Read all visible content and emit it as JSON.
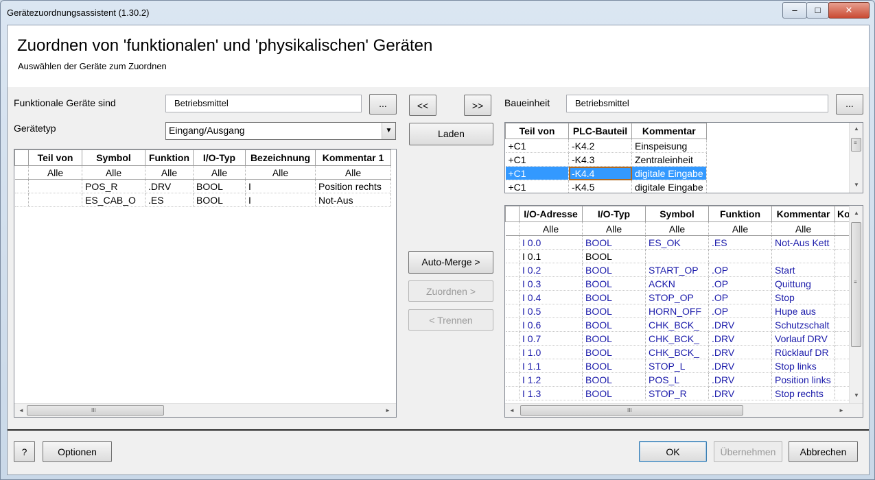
{
  "window": {
    "title": "Gerätezuordnungsassistent (1.30.2)",
    "minimize": "–",
    "maximize": "□",
    "close": "✕"
  },
  "header": {
    "title": "Zuordnen von 'funktionalen' und 'physikalischen' Geräten",
    "subtitle": "Auswählen der Geräte zum Zuordnen"
  },
  "left": {
    "functional_label": "Funktionale Geräte sind",
    "functional_value": "Betriebsmittel",
    "browse": "...",
    "devicetype_label": "Gerätetyp",
    "devicetype_value": "Eingang/Ausgang",
    "columns": [
      "Teil von",
      "Symbol",
      "Funktion",
      "I/O-Typ",
      "Bezeichnung",
      "Kommentar 1"
    ],
    "filter": "Alle",
    "rows": [
      [
        "",
        "POS_R",
        ".DRV",
        "BOOL",
        "I",
        "Position rechts"
      ],
      [
        "",
        "ES_CAB_O",
        ".ES",
        "BOOL",
        "I",
        "Not-Aus"
      ]
    ]
  },
  "middle": {
    "prev": "<<",
    "next": ">>",
    "load": "Laden",
    "auto_merge": "Auto-Merge >",
    "assign": "Zuordnen >",
    "separate": "< Trennen"
  },
  "right": {
    "unit_label": "Baueinheit",
    "unit_value": "Betriebsmittel",
    "browse": "...",
    "top_columns": [
      "Teil von",
      "PLC-Bauteil",
      "Kommentar"
    ],
    "top_rows": [
      [
        "+C1",
        "-K4.2",
        "Einspeisung"
      ],
      [
        "+C1",
        "-K4.3",
        "Zentraleinheit"
      ],
      [
        "+C1",
        "-K4.4",
        "digitale Eingabe"
      ],
      [
        "+C1",
        "-K4.5",
        "digitale Eingabe"
      ]
    ],
    "io_columns": [
      "I/O-Adresse",
      "I/O-Typ",
      "Symbol",
      "Funktion",
      "Kommentar",
      "Ko"
    ],
    "filter": "Alle",
    "io_rows": [
      [
        "I 0.0",
        "BOOL",
        "ES_OK",
        ".ES",
        "Not-Aus Kett"
      ],
      [
        "I 0.1",
        "BOOL",
        "",
        "",
        ""
      ],
      [
        "I 0.2",
        "BOOL",
        "START_OP",
        ".OP",
        "Start"
      ],
      [
        "I 0.3",
        "BOOL",
        "ACKN",
        ".OP",
        "Quittung"
      ],
      [
        "I 0.4",
        "BOOL",
        "STOP_OP",
        ".OP",
        "Stop"
      ],
      [
        "I 0.5",
        "BOOL",
        "HORN_OFF",
        ".OP",
        "Hupe aus"
      ],
      [
        "I 0.6",
        "BOOL",
        "CHK_BCK_",
        ".DRV",
        "Schutzschalt"
      ],
      [
        "I 0.7",
        "BOOL",
        "CHK_BCK_",
        ".DRV",
        "Vorlauf DRV"
      ],
      [
        "I 1.0",
        "BOOL",
        "CHK_BCK_",
        ".DRV",
        "Rücklauf DR"
      ],
      [
        "I 1.1",
        "BOOL",
        "STOP_L",
        ".DRV",
        "Stop links"
      ],
      [
        "I 1.2",
        "BOOL",
        "POS_L",
        ".DRV",
        "Position links"
      ],
      [
        "I 1.3",
        "BOOL",
        "STOP_R",
        ".DRV",
        "Stop rechts"
      ]
    ]
  },
  "footer": {
    "help": "?",
    "options": "Optionen",
    "ok": "OK",
    "apply": "Übernehmen",
    "cancel": "Abbrechen"
  },
  "scroll": {
    "grip": "III",
    "left": "◄",
    "right": "►",
    "up": "▲",
    "down": "▼",
    "vgrip": "≡"
  },
  "colors": {
    "selection": "#3399ff",
    "assigned_text": "#1a1aaa",
    "focus_border": "#b06a20"
  }
}
